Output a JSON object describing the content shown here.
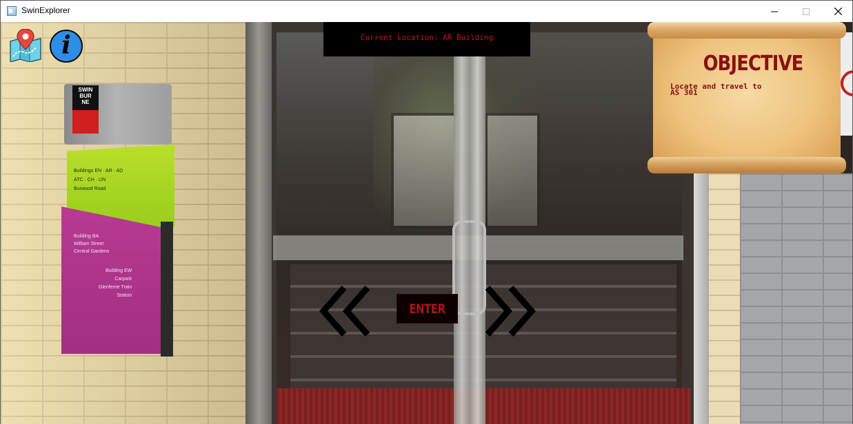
{
  "window": {
    "title": "SwinExplorer",
    "controls": [
      "minimize",
      "maximize",
      "close"
    ]
  },
  "hud": {
    "map_icon": "map-location-icon",
    "info_icon_glyph": "i",
    "location_text": "Current Location: AR Building"
  },
  "objective": {
    "title": "OBJECTIVE",
    "text_line1": "Locate and travel to",
    "text_line2": "AS 301"
  },
  "navigation": {
    "left_glyph": "<<",
    "right_glyph": ">>",
    "enter_label": "ENTER"
  },
  "scene_sign": {
    "logo_line1": "SWIN",
    "logo_line2": "BUR",
    "logo_line3": "NE",
    "green_line1": "Buildings EN · AR · AD",
    "green_line2": "ATC · CH · UN",
    "green_line3": "Burwood Road",
    "pink_line1": "Building BA",
    "pink_line2": "William Street",
    "pink_line3": "Central Gardens",
    "pink_line4": "Building EW",
    "pink_line5": "Carpark",
    "pink_line6": "Glenferrie Train",
    "pink_line7": "Station"
  },
  "colors": {
    "accent_red": "#c8151a",
    "objective_red": "#8c0f12",
    "info_blue": "#2d8ee8"
  }
}
